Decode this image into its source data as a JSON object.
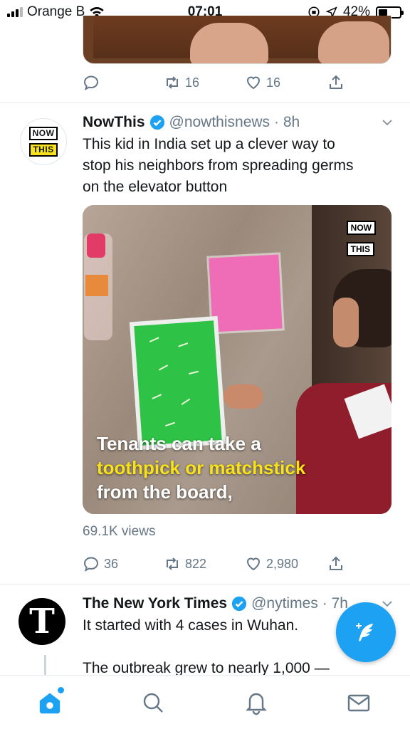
{
  "status_bar": {
    "carrier": "Orange B",
    "time": "07:01",
    "battery": "42%",
    "battery_level": 0.42
  },
  "top_tweet": {
    "retweets": "16",
    "likes": "16"
  },
  "tweet1": {
    "display_name": "NowThis",
    "handle": "@nowthisnews",
    "time": "· 8h",
    "text_line1": "This kid in India set up a clever way to",
    "text_line2": "stop his neighbors from spreading germs",
    "text_line3": "on the elevator button",
    "avatar_top": "NOW",
    "avatar_bottom": "THIS",
    "video": {
      "brand_top": "NOW",
      "brand_bottom": "THIS",
      "caption_line1": "Tenants can take a",
      "caption_line2": "toothpick or matchstick",
      "caption_line3": "from the board,"
    },
    "views": "69.1K views",
    "replies": "36",
    "retweets": "822",
    "likes": "2,980"
  },
  "tweet2": {
    "display_name": "The New York Times",
    "handle": "@nytimes",
    "time": "· 7h",
    "avatar_letter": "T",
    "text_line1": "It started with 4 cases in Wuhan.",
    "text_line2": "The outbreak grew to nearly 1,000 —"
  },
  "icons": {
    "home": "home-icon",
    "search": "search-icon",
    "notifications": "bell-icon",
    "messages": "mail-icon",
    "compose": "compose-feather-icon"
  },
  "colors": {
    "accent": "#1da1f2",
    "muted": "#657786",
    "text": "#14171a"
  }
}
